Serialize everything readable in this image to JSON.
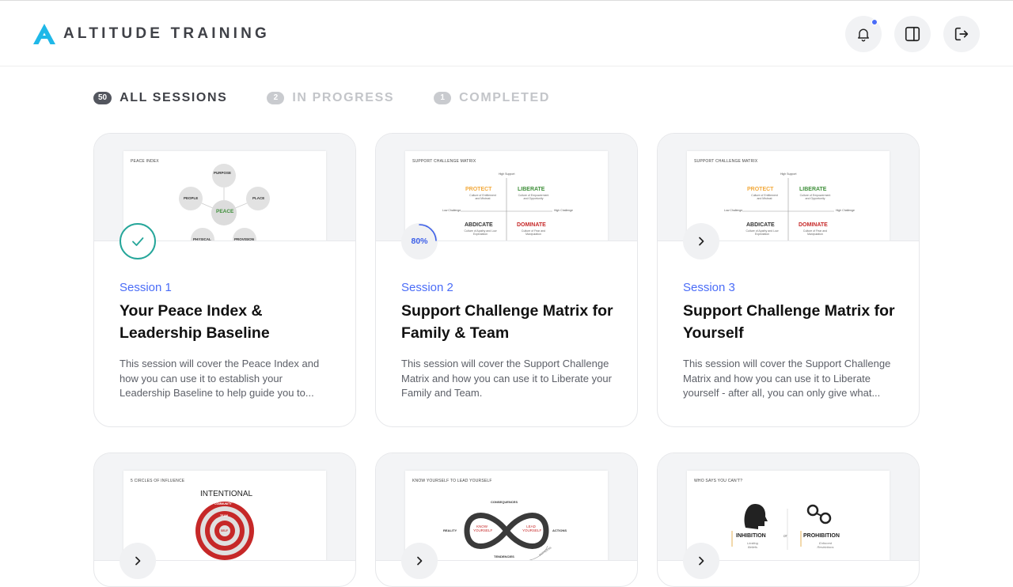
{
  "header": {
    "brand_name": "ALTITUDE TRAINING",
    "logo_letter": "A",
    "accent_color": "#1fb8e8",
    "notification_icon": "bell-icon",
    "panel_icon": "sidebar-panel-icon",
    "logout_icon": "logout-icon"
  },
  "tabs": [
    {
      "count": "50",
      "label": "ALL SESSIONS"
    },
    {
      "count": "2",
      "label": "IN PROGRESS"
    },
    {
      "count": "1",
      "label": "COMPLETED"
    }
  ],
  "cards": [
    {
      "session": "Session 1",
      "title": "Your Peace Index & Leadership Baseline",
      "description": "This session will cover the Peace Index and how you can use it to establish your Leadership Baseline to help guide you to...",
      "status": "completed",
      "slide": {
        "title": "PEACE INDEX",
        "center": "PEACE",
        "nodes": [
          "PURPOSE",
          "PLACE",
          "PEOPLE",
          "PHYSICAL",
          "PROVISION"
        ],
        "node_unit": "%"
      }
    },
    {
      "session": "Session 2",
      "title": "Support Challenge Matrix for Family & Team",
      "description": "This session will cover the Support Challenge Matrix and how you can use it to Liberate your Family and Team.",
      "status": "in-progress",
      "progress_label": "80%",
      "progress": 0.8,
      "slide": {
        "title": "SUPPORT CHALLENGE MATRIX",
        "high_support": "High Support",
        "low_challenge": "Low Challenge",
        "high_challenge": "High Challenge",
        "quadrants": [
          {
            "label": "PROTECT",
            "sub": "Culture of Entitlement and Mistrust",
            "color": "#f2a93b"
          },
          {
            "label": "LIBERATE",
            "sub": "Culture of Empowerment and Opportunity",
            "color": "#3f8f3a"
          },
          {
            "label": "ABDICATE",
            "sub": "Culture of Apathy and Low Expectation",
            "color": "#333333"
          },
          {
            "label": "DOMINATE",
            "sub": "Culture of Fear and Manipulation",
            "color": "#c62828"
          }
        ]
      }
    },
    {
      "session": "Session 3",
      "title": "Support Challenge Matrix for Yourself",
      "description": "This session will cover the Support Challenge Matrix and how you can use it to Liberate yourself - after all, you can only give what...",
      "status": "not-started",
      "slide": {
        "title": "SUPPORT CHALLENGE MATRIX",
        "high_support": "High Support",
        "low_challenge": "Low Challenge",
        "high_challenge": "High Challenge",
        "quadrants": [
          {
            "label": "PROTECT",
            "sub": "Culture of Entitlement and Mistrust",
            "color": "#f2a93b"
          },
          {
            "label": "LIBERATE",
            "sub": "Culture of Empowerment and Opportunity",
            "color": "#3f8f3a"
          },
          {
            "label": "ABDICATE",
            "sub": "Culture of Apathy and Low Expectation",
            "color": "#333333"
          },
          {
            "label": "DOMINATE",
            "sub": "Culture of Fear and Manipulation",
            "color": "#c62828"
          }
        ]
      }
    },
    {
      "status": "not-started",
      "slide": {
        "title": "5 CIRCLES OF INFLUENCE",
        "heading": "INTENTIONAL",
        "rings": [
          "COMMUNITY",
          "FRIENDS",
          "TEAM",
          "FAMILY",
          "SELF"
        ]
      }
    },
    {
      "status": "not-started",
      "slide": {
        "title": "KNOW YOURSELF TO LEAD YOURSELF",
        "top": "CONSEQUENCES",
        "left": "REALITY",
        "right": "ACTIONS",
        "bottom": "TENDENCIES",
        "loop_left": "KNOW YOURSELF",
        "loop_right": "LEAD YOURSELF",
        "arc": "PATTERNS"
      }
    },
    {
      "status": "not-started",
      "slide": {
        "title": "WHO SAYS YOU CAN'T?",
        "left_label": "INHIBITION",
        "left_sub": "Limiting Beliefs",
        "middle": "or",
        "right_label": "PROHIBITION",
        "right_sub": "Enforced Restrictions"
      }
    }
  ]
}
